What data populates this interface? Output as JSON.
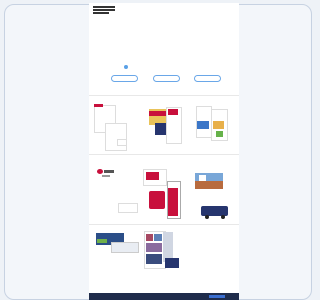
{
  "brand": {
    "logo_text": "",
    "accent": "#c8103c",
    "link_color": "#4a8bd6",
    "navy": "#26356e"
  },
  "nav": {
    "items": [
      "",
      "",
      ""
    ]
  },
  "hero": {
    "title_line1": "",
    "title_line2": "",
    "subtitle": "",
    "buttons": [
      "",
      "",
      ""
    ]
  },
  "footer": {
    "text": "",
    "button_label": ""
  }
}
